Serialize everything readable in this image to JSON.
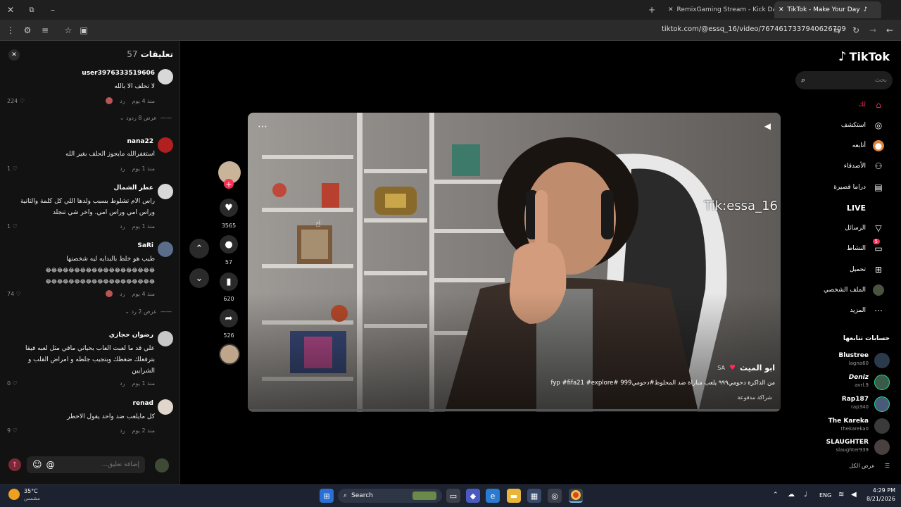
{
  "browser": {
    "tabs": [
      {
        "title": "RemixGaming Stream - Kick Da",
        "active": false
      },
      {
        "title": "TikTok - Make Your Day",
        "active": true
      }
    ],
    "url": "tiktok.com/@essq_16/video/7674617337940626709"
  },
  "comments_panel": {
    "title": "تعليقات",
    "count": "57",
    "comments": [
      {
        "user": "user3976333519606",
        "text": "لا تحلف الا بالله",
        "time": "منذ 4 يوم",
        "reply": "رد",
        "likes": "224",
        "view_replies": "عرض 8 ردود"
      },
      {
        "user": "nana22",
        "text": "استغفرالله مايجوز الحلف بغير الله",
        "time": "منذ 1 يوم",
        "reply": "رد",
        "likes": "1"
      },
      {
        "user": "عطر الشمال",
        "text_lines": [
          "راس الام تشلوط بسبب ولدها اللي كل كلمة والثانية",
          "وراس امي وراس امي. واخر شي تنجلد"
        ],
        "time": "منذ 1 يوم",
        "reply": "رد",
        "likes": "1"
      },
      {
        "user": "SaRi",
        "text_lines": [
          "طيب هو خلط بالبدايه ليه شخصنها",
          "😂😂😂😂😂😂😂😂😂😂😂😂😂😂😂😂😂😂😂",
          "😂😂😂😂😂😂😂😂😂😂😂😂😂😂😂😂😂😂😂"
        ],
        "time": "منذ 4 يوم",
        "reply": "رد",
        "likes": "74",
        "view_replies": "عرض 2 رد"
      },
      {
        "user": "رضوان حجازي",
        "text_lines": [
          "علي قد ما لعبت العاب بحياتي مافي مثل لعبه فيفا",
          "بترفعلك ضغطك وبتجيب جلطه و امراض القلب و",
          "الشرايين"
        ],
        "time": "منذ 1 يوم",
        "reply": "رد",
        "likes": "0"
      },
      {
        "user": "renad",
        "text": "كل مايلعب ضد واحد يقول الاخطر",
        "time": "منذ 2 يوم",
        "reply": "رد",
        "likes": "9"
      }
    ],
    "input_placeholder": "إضافة تعليق..."
  },
  "actions": {
    "likes": "3565",
    "comments": "57",
    "saves": "620",
    "shares": "526"
  },
  "video": {
    "watermark": "Tik:essa_16",
    "author": "ابو الميث",
    "author_badge": "SA",
    "caption": "من الذاكرة دحومي٩٩٩ يلعب مباراة ضد المحلوظ#دحومي999 #fyp #fifa21 #explore",
    "sponsored": "شراكة مدفوعة"
  },
  "sidebar": {
    "logo": "TikTok",
    "search_placeholder": "بحث",
    "nav": [
      {
        "label": "لك",
        "icon": "home-icon",
        "active": true
      },
      {
        "label": "استكشف",
        "icon": "compass-icon"
      },
      {
        "label": "أتابعه",
        "icon": "following-icon"
      },
      {
        "label": "الأصدقاء",
        "icon": "friends-icon"
      },
      {
        "label": "دراما قصيرة",
        "icon": "drama-icon"
      },
      {
        "label": "LIVE",
        "icon": "live-icon"
      },
      {
        "label": "الرسائل",
        "icon": "messages-icon"
      },
      {
        "label": "النشاط",
        "icon": "activity-icon",
        "badge": "5"
      },
      {
        "label": "تحميل",
        "icon": "upload-icon"
      },
      {
        "label": "الملف الشخصي",
        "icon": "profile-icon"
      },
      {
        "label": "المزيد",
        "icon": "more-icon"
      }
    ],
    "following_title": "حسابات تتابعها",
    "following": [
      {
        "name": "Blustree",
        "handle": "lagna60"
      },
      {
        "name": "Deniz",
        "handle": "avrl.9"
      },
      {
        "name": "Rap187",
        "handle": "rap340"
      },
      {
        "name": "The Kareka",
        "handle": "thekareka0"
      },
      {
        "name": "SLAUGHTER",
        "handle": "slaughter939"
      }
    ],
    "see_all": "عرض الكل"
  },
  "taskbar": {
    "weather_temp": "35°C",
    "weather_desc": "مشمس",
    "search": "Search",
    "lang": "ENG",
    "time": "4:29 PM",
    "date": "8/21/2026"
  }
}
